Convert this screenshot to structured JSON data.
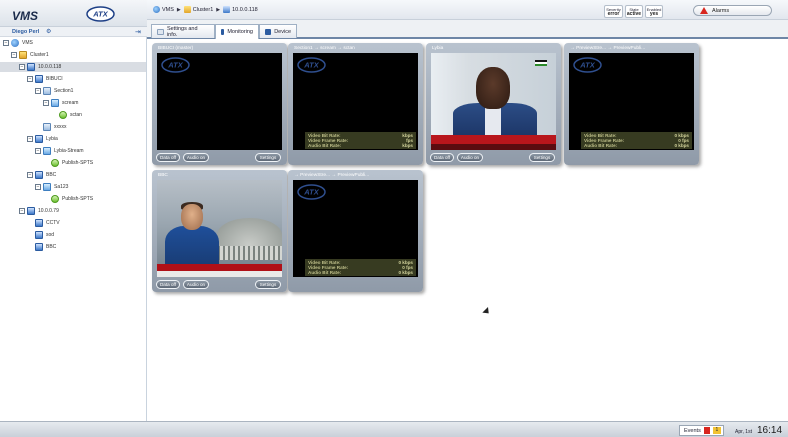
{
  "app": {
    "brand": "VMS",
    "logo_text": "ATX",
    "user": "Diego Perl"
  },
  "tree": [
    {
      "label": "VMS",
      "indent": 0,
      "type": "globe",
      "exp": "−"
    },
    {
      "label": "Cluster1",
      "indent": 1,
      "type": "group",
      "exp": "−"
    },
    {
      "label": "10.0.0.118",
      "indent": 2,
      "type": "device",
      "exp": "−",
      "selected": true
    },
    {
      "label": "BIBUCI",
      "indent": 3,
      "type": "device",
      "exp": "−"
    },
    {
      "label": "Section1",
      "indent": 4,
      "type": "section",
      "exp": "−"
    },
    {
      "label": "scream",
      "indent": 5,
      "type": "stream",
      "exp": "−"
    },
    {
      "label": "sctan",
      "indent": 6,
      "type": "output",
      "exp": ""
    },
    {
      "label": "xxxxx",
      "indent": 4,
      "type": "section",
      "exp": ""
    },
    {
      "label": "Lybia",
      "indent": 3,
      "type": "device",
      "exp": "−"
    },
    {
      "label": "Lybia-Stream",
      "indent": 4,
      "type": "stream",
      "exp": "−"
    },
    {
      "label": "Publish-SPTS",
      "indent": 5,
      "type": "output",
      "exp": ""
    },
    {
      "label": "BBC",
      "indent": 3,
      "type": "device",
      "exp": "−"
    },
    {
      "label": "Sa123",
      "indent": 4,
      "type": "stream",
      "exp": "−"
    },
    {
      "label": "Publish-SPTS",
      "indent": 5,
      "type": "output",
      "exp": ""
    },
    {
      "label": "10.0.0.79",
      "indent": 2,
      "type": "device",
      "exp": "−"
    },
    {
      "label": "CCTV",
      "indent": 3,
      "type": "down",
      "exp": ""
    },
    {
      "label": "sod",
      "indent": 3,
      "type": "down",
      "exp": ""
    },
    {
      "label": "BBC",
      "indent": 3,
      "type": "down",
      "exp": ""
    }
  ],
  "breadcrumb": [
    "VMS",
    "Cluster1",
    "10.0.0.118"
  ],
  "status": {
    "severity_label": "Severity",
    "severity_value": "error",
    "state_label": "State",
    "state_value": "active",
    "enabled_label": "Enabled",
    "enabled_value": "yes"
  },
  "alarms_label": "Alarms",
  "tabs": [
    {
      "label": "Settings and info.",
      "active": false
    },
    {
      "label": "Monitoring",
      "active": true
    },
    {
      "label": "Device",
      "active": false
    }
  ],
  "panels": [
    {
      "title": "BIBUCI (master)",
      "video": "none",
      "show_stats": false
    },
    {
      "title": "Section1 → scream → sctan",
      "video": "none",
      "show_stats": true,
      "bitrate": "kbps",
      "framerate": "fps",
      "audio": "kbps"
    },
    {
      "title": "Lybia",
      "video": "lybia",
      "show_stats": false
    },
    {
      "title": "→ PreviewStre... → PreviewPubli...",
      "video": "none",
      "show_stats": true,
      "bitrate": "0 kbps",
      "framerate": "0 fps",
      "audio": "0 kbps"
    },
    {
      "title": "BBC",
      "video": "bbc",
      "show_stats": false
    },
    {
      "title": "→ PreviewStre... → PreviewPubli...",
      "video": "none",
      "show_stats": true,
      "bitrate": "0 kbps",
      "framerate": "0 fps",
      "audio": "0 kbps"
    }
  ],
  "stat_labels": {
    "bitrate": "Video Bit Rate:",
    "framerate": "Video Frame Rate:",
    "audio": "Audio Bit Rate:"
  },
  "buttons": {
    "data_off": "Data off",
    "audio_on": "Audio on",
    "settings": "Settings"
  },
  "footer": {
    "events_label": "Events",
    "event_badge": "1",
    "date": "Apr, 1st",
    "time": "16:14"
  },
  "colors": {
    "accent": "#2a5aa0",
    "alarm": "#d8261f",
    "panel": "#a3adba"
  }
}
